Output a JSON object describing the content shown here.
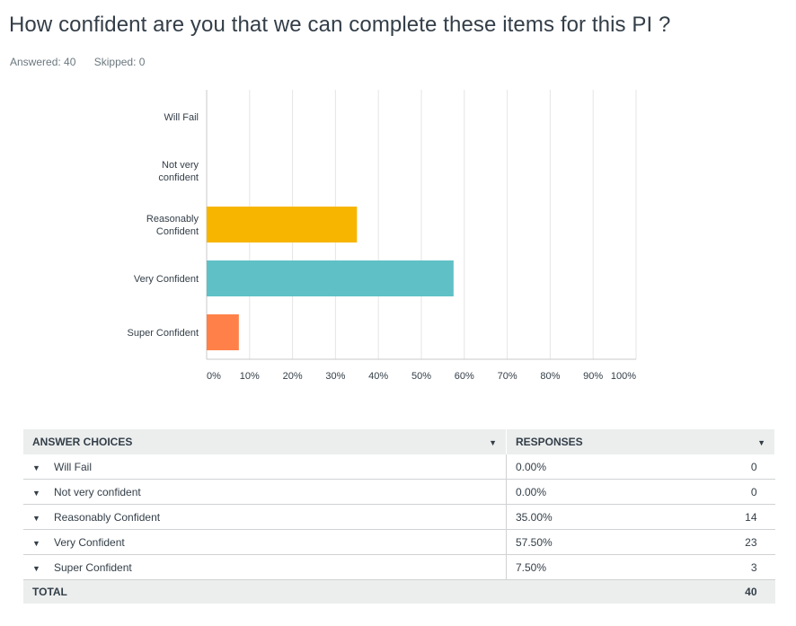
{
  "title": "How confident are you that we can complete these items for this PI ?",
  "stats": {
    "answered": "Answered: 40",
    "skipped": "Skipped: 0"
  },
  "chart_data": {
    "type": "bar",
    "orientation": "horizontal",
    "categories": [
      "Will Fail",
      "Not very confident",
      "Reasonably Confident",
      "Very Confident",
      "Super Confident"
    ],
    "category_labels": [
      [
        "Will Fail"
      ],
      [
        "Not very",
        "confident"
      ],
      [
        "Reasonably",
        "Confident"
      ],
      [
        "Very Confident"
      ],
      [
        "Super Confident"
      ]
    ],
    "values": [
      0,
      0,
      35,
      57.5,
      7.5
    ],
    "colors": [
      "#757d82",
      "#757d82",
      "#f7b500",
      "#5fc1c6",
      "#ff8149"
    ],
    "xlim": [
      0,
      100
    ],
    "xticks": [
      "0%",
      "10%",
      "20%",
      "30%",
      "40%",
      "50%",
      "60%",
      "70%",
      "80%",
      "90%",
      "100%"
    ],
    "grid": true
  },
  "table": {
    "headers": [
      "ANSWER CHOICES",
      "RESPONSES"
    ],
    "rows": [
      {
        "choice": "Will Fail",
        "percent": "0.00%",
        "count": "0"
      },
      {
        "choice": "Not very confident",
        "percent": "0.00%",
        "count": "0"
      },
      {
        "choice": "Reasonably Confident",
        "percent": "35.00%",
        "count": "14"
      },
      {
        "choice": "Very Confident",
        "percent": "57.50%",
        "count": "23"
      },
      {
        "choice": "Super Confident",
        "percent": "7.50%",
        "count": "3"
      }
    ],
    "total_label": "TOTAL",
    "total_value": "40"
  }
}
